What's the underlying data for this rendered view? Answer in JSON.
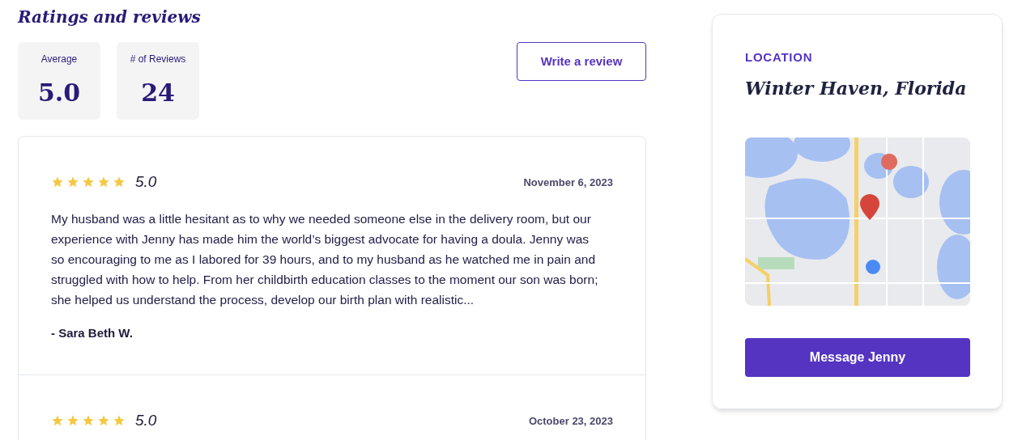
{
  "reviews_section": {
    "title": "Ratings and reviews",
    "stats": [
      {
        "label": "Average",
        "value": "5.0"
      },
      {
        "label": "# of Reviews",
        "value": "24"
      }
    ],
    "write_button": "Write a review",
    "reviews": [
      {
        "stars": 5,
        "rating": "5.0",
        "date": "November 6, 2023",
        "text": "My husband was a little hesitant as to why we needed someone else in the delivery room, but our experience with Jenny has made him the world’s biggest advocate for having a doula. Jenny was so encouraging to me as I labored for 39 hours, and to my husband as he watched me in pain and struggled with how to help. From her childbirth education classes to the moment our son was born; she helped us understand the process, develop our birth plan with realistic...",
        "author": "- Sara Beth W."
      },
      {
        "stars": 5,
        "rating": "5.0",
        "date": "October 23, 2023"
      }
    ]
  },
  "location_card": {
    "label": "LOCATION",
    "place": "Winter Haven, Florida",
    "button": "Message Jenny"
  }
}
